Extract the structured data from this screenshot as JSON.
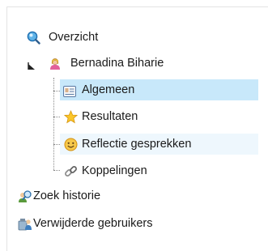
{
  "tree": {
    "overview": {
      "label": "Overzicht",
      "icon": "magnifier-icon"
    },
    "user": {
      "label": "Bernadina Biharie",
      "icon": "user-female-icon",
      "expander": "expanded-arrow-icon"
    },
    "children": [
      {
        "label": "Algemeen",
        "icon": "id-card-icon",
        "state": "selected"
      },
      {
        "label": "Resultaten",
        "icon": "star-icon",
        "state": "normal"
      },
      {
        "label": "Reflectie gesprekken",
        "icon": "smiley-icon",
        "state": "hover"
      },
      {
        "label": "Koppelingen",
        "icon": "link-icon",
        "state": "normal"
      }
    ],
    "search_history": {
      "label": "Zoek historie",
      "icon": "user-search-icon"
    },
    "deleted_users": {
      "label": "Verwijderde gebruikers",
      "icon": "users-deleted-icon"
    }
  },
  "colors": {
    "selected_bg": "#c8e8fa",
    "hover_bg": "#eef7fd"
  }
}
